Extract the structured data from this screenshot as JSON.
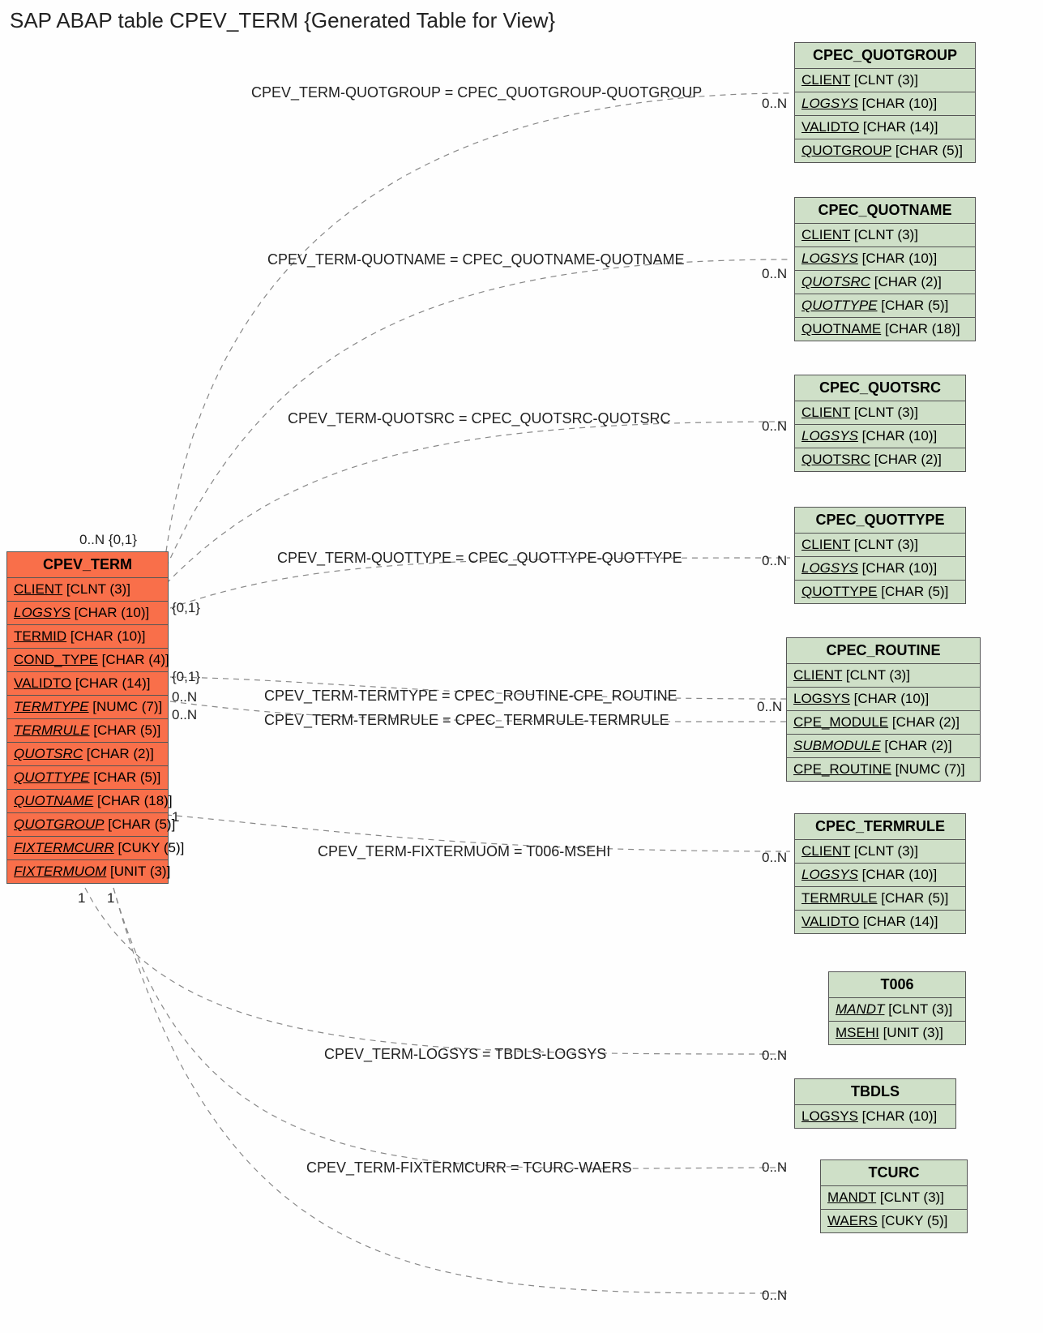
{
  "title": "SAP ABAP table CPEV_TERM {Generated Table for View}",
  "main_table": {
    "name": "CPEV_TERM",
    "fields": [
      {
        "name": "CLIENT",
        "type": "[CLNT (3)]",
        "italic": false
      },
      {
        "name": "LOGSYS",
        "type": "[CHAR (10)]",
        "italic": true
      },
      {
        "name": "TERMID",
        "type": "[CHAR (10)]",
        "italic": false
      },
      {
        "name": "COND_TYPE",
        "type": "[CHAR (4)]",
        "italic": false
      },
      {
        "name": "VALIDTO",
        "type": "[CHAR (14)]",
        "italic": false
      },
      {
        "name": "TERMTYPE",
        "type": "[NUMC (7)]",
        "italic": true
      },
      {
        "name": "TERMRULE",
        "type": "[CHAR (5)]",
        "italic": true
      },
      {
        "name": "QUOTSRC",
        "type": "[CHAR (2)]",
        "italic": true
      },
      {
        "name": "QUOTTYPE",
        "type": "[CHAR (5)]",
        "italic": true
      },
      {
        "name": "QUOTNAME",
        "type": "[CHAR (18)]",
        "italic": true
      },
      {
        "name": "QUOTGROUP",
        "type": "[CHAR (5)]",
        "italic": true
      },
      {
        "name": "FIXTERMCURR",
        "type": "[CUKY (5)]",
        "italic": true
      },
      {
        "name": "FIXTERMUOM",
        "type": "[UNIT (3)]",
        "italic": true
      }
    ]
  },
  "ref_tables": [
    {
      "name": "CPEC_QUOTGROUP",
      "fields": [
        {
          "name": "CLIENT",
          "type": "[CLNT (3)]",
          "italic": false
        },
        {
          "name": "LOGSYS",
          "type": "[CHAR (10)]",
          "italic": true
        },
        {
          "name": "VALIDTO",
          "type": "[CHAR (14)]",
          "italic": false
        },
        {
          "name": "QUOTGROUP",
          "type": "[CHAR (5)]",
          "italic": false
        }
      ]
    },
    {
      "name": "CPEC_QUOTNAME",
      "fields": [
        {
          "name": "CLIENT",
          "type": "[CLNT (3)]",
          "italic": false
        },
        {
          "name": "LOGSYS",
          "type": "[CHAR (10)]",
          "italic": true
        },
        {
          "name": "QUOTSRC",
          "type": "[CHAR (2)]",
          "italic": true
        },
        {
          "name": "QUOTTYPE",
          "type": "[CHAR (5)]",
          "italic": true
        },
        {
          "name": "QUOTNAME",
          "type": "[CHAR (18)]",
          "italic": false
        }
      ]
    },
    {
      "name": "CPEC_QUOTSRC",
      "fields": [
        {
          "name": "CLIENT",
          "type": "[CLNT (3)]",
          "italic": false
        },
        {
          "name": "LOGSYS",
          "type": "[CHAR (10)]",
          "italic": true
        },
        {
          "name": "QUOTSRC",
          "type": "[CHAR (2)]",
          "italic": false
        }
      ]
    },
    {
      "name": "CPEC_QUOTTYPE",
      "fields": [
        {
          "name": "CLIENT",
          "type": "[CLNT (3)]",
          "italic": false
        },
        {
          "name": "LOGSYS",
          "type": "[CHAR (10)]",
          "italic": true
        },
        {
          "name": "QUOTTYPE",
          "type": "[CHAR (5)]",
          "italic": false
        }
      ]
    },
    {
      "name": "CPEC_ROUTINE",
      "fields": [
        {
          "name": "CLIENT",
          "type": "[CLNT (3)]",
          "italic": false
        },
        {
          "name": "LOGSYS",
          "type": "[CHAR (10)]",
          "italic": false
        },
        {
          "name": "CPE_MODULE",
          "type": "[CHAR (2)]",
          "italic": false
        },
        {
          "name": "SUBMODULE",
          "type": "[CHAR (2)]",
          "italic": true
        },
        {
          "name": "CPE_ROUTINE",
          "type": "[NUMC (7)]",
          "italic": false
        }
      ]
    },
    {
      "name": "CPEC_TERMRULE",
      "fields": [
        {
          "name": "CLIENT",
          "type": "[CLNT (3)]",
          "italic": false
        },
        {
          "name": "LOGSYS",
          "type": "[CHAR (10)]",
          "italic": true
        },
        {
          "name": "TERMRULE",
          "type": "[CHAR (5)]",
          "italic": false
        },
        {
          "name": "VALIDTO",
          "type": "[CHAR (14)]",
          "italic": false
        }
      ]
    },
    {
      "name": "T006",
      "fields": [
        {
          "name": "MANDT",
          "type": "[CLNT (3)]",
          "italic": true
        },
        {
          "name": "MSEHI",
          "type": "[UNIT (3)]",
          "italic": false
        }
      ]
    },
    {
      "name": "TBDLS",
      "fields": [
        {
          "name": "LOGSYS",
          "type": "[CHAR (10)]",
          "italic": false
        }
      ]
    },
    {
      "name": "TCURC",
      "fields": [
        {
          "name": "MANDT",
          "type": "[CLNT (3)]",
          "italic": false
        },
        {
          "name": "WAERS",
          "type": "[CUKY (5)]",
          "italic": false
        }
      ]
    }
  ],
  "relations": [
    {
      "label": "CPEV_TERM-QUOTGROUP = CPEC_QUOTGROUP-QUOTGROUP",
      "right_card": "0..N"
    },
    {
      "label": "CPEV_TERM-QUOTNAME = CPEC_QUOTNAME-QUOTNAME",
      "right_card": "0..N"
    },
    {
      "label": "CPEV_TERM-QUOTSRC = CPEC_QUOTSRC-QUOTSRC",
      "right_card": "0..N"
    },
    {
      "label": "CPEV_TERM-QUOTTYPE = CPEC_QUOTTYPE-QUOTTYPE",
      "right_card": "0..N"
    },
    {
      "label": "CPEV_TERM-TERMTYPE = CPEC_ROUTINE-CPE_ROUTINE",
      "right_card": "0..N"
    },
    {
      "label": "CPEV_TERM-TERMRULE = CPEC_TERMRULE-TERMRULE",
      "right_card": ""
    },
    {
      "label": "CPEV_TERM-FIXTERMUOM = T006-MSEHI",
      "right_card": "0..N"
    },
    {
      "label": "CPEV_TERM-LOGSYS = TBDLS-LOGSYS",
      "right_card": "0..N"
    },
    {
      "label": "CPEV_TERM-FIXTERMCURR = TCURC-WAERS",
      "right_card": "0..N"
    }
  ],
  "left_cards": {
    "top_pair": "0..N {0,1}",
    "c3": "{0,1}",
    "c4": "{0,1}",
    "c5a": "0..N",
    "c5b": "0..N",
    "c6": "1",
    "bottom_a": "1",
    "bottom_b": "1"
  }
}
